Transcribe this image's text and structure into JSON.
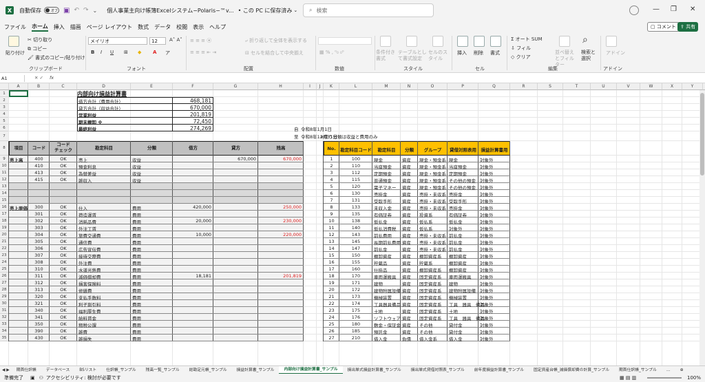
{
  "title_bar": {
    "autosave": "自動保存",
    "toggle": "オフ",
    "doc_title": "個人事業主向け帳簿Excelシステム−Polaris−™v...",
    "save_state": "• この PC に保存済み",
    "search_placeholder": "検索"
  },
  "menu": {
    "tabs": [
      "ファイル",
      "ホーム",
      "挿入",
      "描画",
      "ページ レイアウト",
      "数式",
      "データ",
      "校閲",
      "表示",
      "ヘルプ"
    ],
    "active": "ホーム",
    "comment": "コメント",
    "share": "共有"
  },
  "ribbon": {
    "clipboard": {
      "label": "クリップボード",
      "paste": "貼り付け",
      "cut": "切り取り",
      "copy": "コピー",
      "format_painter": "書式のコピー/貼り付け"
    },
    "font": {
      "label": "フォント",
      "name": "メイリオ",
      "size": "12",
      "bold": "B",
      "italic": "I",
      "underline": "U"
    },
    "alignment": {
      "label": "配置",
      "wrap": "折り返して全体を表示する",
      "merge": "セルを結合して中央揃え"
    },
    "number": {
      "label": "数値"
    },
    "styles": {
      "label": "スタイル",
      "cond": "条件付き書式",
      "table": "テーブルとして書式設定",
      "cell": "セルのスタイル"
    },
    "cells": {
      "label": "セル",
      "insert": "挿入",
      "delete": "削除",
      "format": "書式"
    },
    "editing": {
      "label": "編集",
      "autosum": "オート SUM",
      "fill": "フィル",
      "clear": "クリア",
      "sort": "並べ替えとフィルター",
      "find": "検索と選択"
    },
    "addin": {
      "label": "アドイン",
      "addin": "アドイン"
    }
  },
  "formula_bar": {
    "name_box": "A1",
    "fx": "fx"
  },
  "columns": [
    "A",
    "B",
    "C",
    "D",
    "E",
    "F",
    "G",
    "H",
    "I",
    "J",
    "K",
    "L",
    "M",
    "N",
    "O",
    "P",
    "Q",
    "R",
    "S",
    "T",
    "U",
    "V",
    "W",
    "X",
    "Y",
    "Z",
    "AA",
    "AB",
    "AC"
  ],
  "sheet": {
    "title": "内部向け損益計算書",
    "summary": [
      {
        "label": "借方合計（費用合計）",
        "value": "468,181"
      },
      {
        "label": "貸方合計（収益合計）",
        "value": "670,000"
      },
      {
        "label": "営業利益",
        "value": "201,819"
      },
      {
        "label": "期末棚卸 ※",
        "value": "72,450"
      },
      {
        "label": "最終利益",
        "value": "274,269"
      }
    ],
    "period_from_label": "自",
    "period_from": "令和8年1月1日",
    "period_to_label": "至",
    "period_to": "令和8年12月31日",
    "headers": {
      "item": "項目",
      "code": "コード",
      "code_check": "コード\nチェック",
      "account": "勘定科目",
      "category": "分類",
      "debit": "借方",
      "credit": "貸方",
      "balance": "残高"
    },
    "group_sales": "売上高",
    "group_cost": "売上原価",
    "rows": [
      {
        "row": "9",
        "group": "売上高",
        "code": "400",
        "check": "OK",
        "account": "売上",
        "category": "収益",
        "debit": "",
        "credit": "670,000",
        "balance": "670,000"
      },
      {
        "row": "10",
        "code": "410",
        "check": "OK",
        "account": "預金利息",
        "category": "収益"
      },
      {
        "row": "11",
        "code": "413",
        "check": "OK",
        "account": "為替差益",
        "category": "収益"
      },
      {
        "row": "12",
        "code": "415",
        "check": "OK",
        "account": "雑収入",
        "category": "収益"
      },
      {
        "row": "13",
        "blank": true
      },
      {
        "row": "14",
        "blank": true
      },
      {
        "row": "15",
        "blank": true
      },
      {
        "row": "16",
        "group": "売上原価",
        "code": "300",
        "check": "OK",
        "account": "仕入",
        "category": "費用",
        "debit": "420,000",
        "balance": "250,000"
      },
      {
        "row": "17",
        "code": "301",
        "check": "OK",
        "account": "荷造運賃",
        "category": "費用"
      },
      {
        "row": "18",
        "code": "302",
        "check": "OK",
        "account": "消耗品費",
        "category": "費用",
        "debit": "20,000",
        "balance": "230,000"
      },
      {
        "row": "19",
        "code": "303",
        "check": "OK",
        "account": "外注工賃",
        "category": "費用"
      },
      {
        "row": "20",
        "code": "304",
        "check": "OK",
        "account": "旅費交通費",
        "category": "費用",
        "debit": "10,000",
        "balance": "220,000"
      },
      {
        "row": "21",
        "code": "305",
        "check": "OK",
        "account": "通信費",
        "category": "費用"
      },
      {
        "row": "22",
        "code": "306",
        "check": "OK",
        "account": "広告宣伝費",
        "category": "費用"
      },
      {
        "row": "23",
        "code": "307",
        "check": "OK",
        "account": "接待交際費",
        "category": "費用"
      },
      {
        "row": "24",
        "code": "308",
        "check": "OK",
        "account": "外注費",
        "category": "費用"
      },
      {
        "row": "25",
        "code": "310",
        "check": "OK",
        "account": "水道光熱費",
        "category": "費用"
      },
      {
        "row": "26",
        "code": "311",
        "check": "OK",
        "account": "減価償却費",
        "category": "費用",
        "debit": "18,181",
        "balance": "201,819"
      },
      {
        "row": "27",
        "code": "312",
        "check": "OK",
        "account": "損害保険料",
        "category": "費用"
      },
      {
        "row": "28",
        "code": "313",
        "check": "OK",
        "account": "修繕費",
        "category": "費用"
      },
      {
        "row": "29",
        "code": "320",
        "check": "OK",
        "account": "支払手数料",
        "category": "費用"
      },
      {
        "row": "30",
        "code": "321",
        "check": "OK",
        "account": "利子割引料",
        "category": "費用"
      },
      {
        "row": "31",
        "code": "340",
        "check": "OK",
        "account": "福利厚生費",
        "category": "費用"
      },
      {
        "row": "32",
        "code": "341",
        "check": "OK",
        "account": "給料賃金",
        "category": "費用"
      },
      {
        "row": "33",
        "code": "350",
        "check": "OK",
        "account": "租税公課",
        "category": "費用"
      },
      {
        "row": "34",
        "code": "390",
        "check": "OK",
        "account": "雑費",
        "category": "費用"
      },
      {
        "row": "35",
        "code": "430",
        "check": "OK",
        "account": "雑損失",
        "category": "費用"
      }
    ],
    "note": "※使う分類は収益と費用のみ",
    "right_headers": [
      "No.",
      "勘定科目コード",
      "勘定科目",
      "分類",
      "グループ",
      "貸借対照表用",
      "損益計算書用"
    ],
    "right_rows": [
      [
        "1",
        "100",
        "現金",
        "資産",
        "現金・預金系",
        "現金",
        "対象外"
      ],
      [
        "2",
        "110",
        "当座預金",
        "資産",
        "現金・預金系",
        "当座預金",
        "対象外"
      ],
      [
        "3",
        "112",
        "定期預金",
        "資産",
        "現金・預金系",
        "定期預金",
        "対象外"
      ],
      [
        "4",
        "115",
        "普通預金",
        "資産",
        "現金・預金系",
        "その他の預金",
        "対象外"
      ],
      [
        "5",
        "120",
        "電子マネー",
        "資産",
        "現金・預金系",
        "その他の預金",
        "対象外"
      ],
      [
        "6",
        "130",
        "売掛金",
        "資産",
        "売掛・未収系",
        "売掛金",
        "対象外"
      ],
      [
        "7",
        "131",
        "受取手形",
        "資産",
        "売掛・未収系",
        "受取手形",
        "対象外"
      ],
      [
        "8",
        "133",
        "未収入金",
        "資産",
        "売掛・未収系",
        "売掛金",
        "対象外"
      ],
      [
        "9",
        "135",
        "有価証券",
        "資産",
        "投資系",
        "有価証券",
        "対象外"
      ],
      [
        "10",
        "138",
        "仮払金",
        "資産",
        "仮払系",
        "仮払金",
        "対象外"
      ],
      [
        "11",
        "140",
        "仮払消費税",
        "資産",
        "仮払系",
        "対象外",
        "対象外"
      ],
      [
        "12",
        "143",
        "前払費用",
        "資産",
        "売掛・未収系",
        "前払金",
        "対象外"
      ],
      [
        "13",
        "145",
        "長期前払費用",
        "資産",
        "売掛・未収系",
        "前払金",
        "対象外"
      ],
      [
        "14",
        "147",
        "前払金",
        "資産",
        "売掛・未収系",
        "前払金",
        "対象外"
      ],
      [
        "15",
        "150",
        "棚卸資産",
        "資産",
        "棚卸資産系",
        "棚卸資産",
        "対象外"
      ],
      [
        "16",
        "155",
        "貯蔵品",
        "資産",
        "貯蔵系",
        "棚卸資産",
        "対象外"
      ],
      [
        "17",
        "160",
        "仕掛品",
        "資産",
        "棚卸資産系",
        "棚卸資産",
        "対象外"
      ],
      [
        "18",
        "170",
        "車両運搬具",
        "資産",
        "固定資産系",
        "車両運搬具",
        "対象外"
      ],
      [
        "19",
        "171",
        "建物",
        "資産",
        "固定資産系",
        "建物",
        "対象外"
      ],
      [
        "20",
        "172",
        "建物附属設備",
        "資産",
        "固定資産系",
        "建物附属設備",
        "対象外"
      ],
      [
        "21",
        "173",
        "機械装置",
        "資産",
        "固定資産系",
        "機械装置",
        "対象外"
      ],
      [
        "22",
        "174",
        "工具器具備品",
        "資産",
        "固定資産系",
        "工具　器具　備品",
        "対象外"
      ],
      [
        "23",
        "175",
        "土地",
        "資産",
        "固定資産系",
        "土地",
        "対象外"
      ],
      [
        "24",
        "176",
        "ソフトウェア",
        "資産",
        "固定資産系",
        "工具　器具　備品",
        "対象外"
      ],
      [
        "25",
        "180",
        "敷金・保証金",
        "資産",
        "その他",
        "貸付金",
        "対象外"
      ],
      [
        "26",
        "185",
        "預託金",
        "資産",
        "その他",
        "貸付金",
        "対象外"
      ],
      [
        "27",
        "210",
        "借入金",
        "負債",
        "借入金系",
        "借入金",
        "対象外"
      ]
    ]
  },
  "sheet_tabs": [
    "期首仕訳帳",
    "データベース",
    "BSリスト",
    "仕訳帳_サンプル",
    "残高一覧_サンプル",
    "総勘定元帳_サンプル",
    "損益計算書_サンプル",
    "内部向け損益計算書_サンプル",
    "損出単式損益計算書_サンプル",
    "損出単式貸借対照表_サンプル",
    "前年度損益計算書_サンプル",
    "固定資産台帳_減価償却費の計算_サンプル",
    "期首仕訳帳_サンプル"
  ],
  "active_sheet": "内部向け損益計算書_サンプル",
  "status": {
    "ready": "準備完了",
    "accessibility": "アクセシビリティ: 検討が必要です",
    "zoom": "100%"
  },
  "colors": {
    "accent": "#1d6f42",
    "header_fill": "#c0c0c0",
    "orange": "#ffc000",
    "red": "#e02020"
  }
}
